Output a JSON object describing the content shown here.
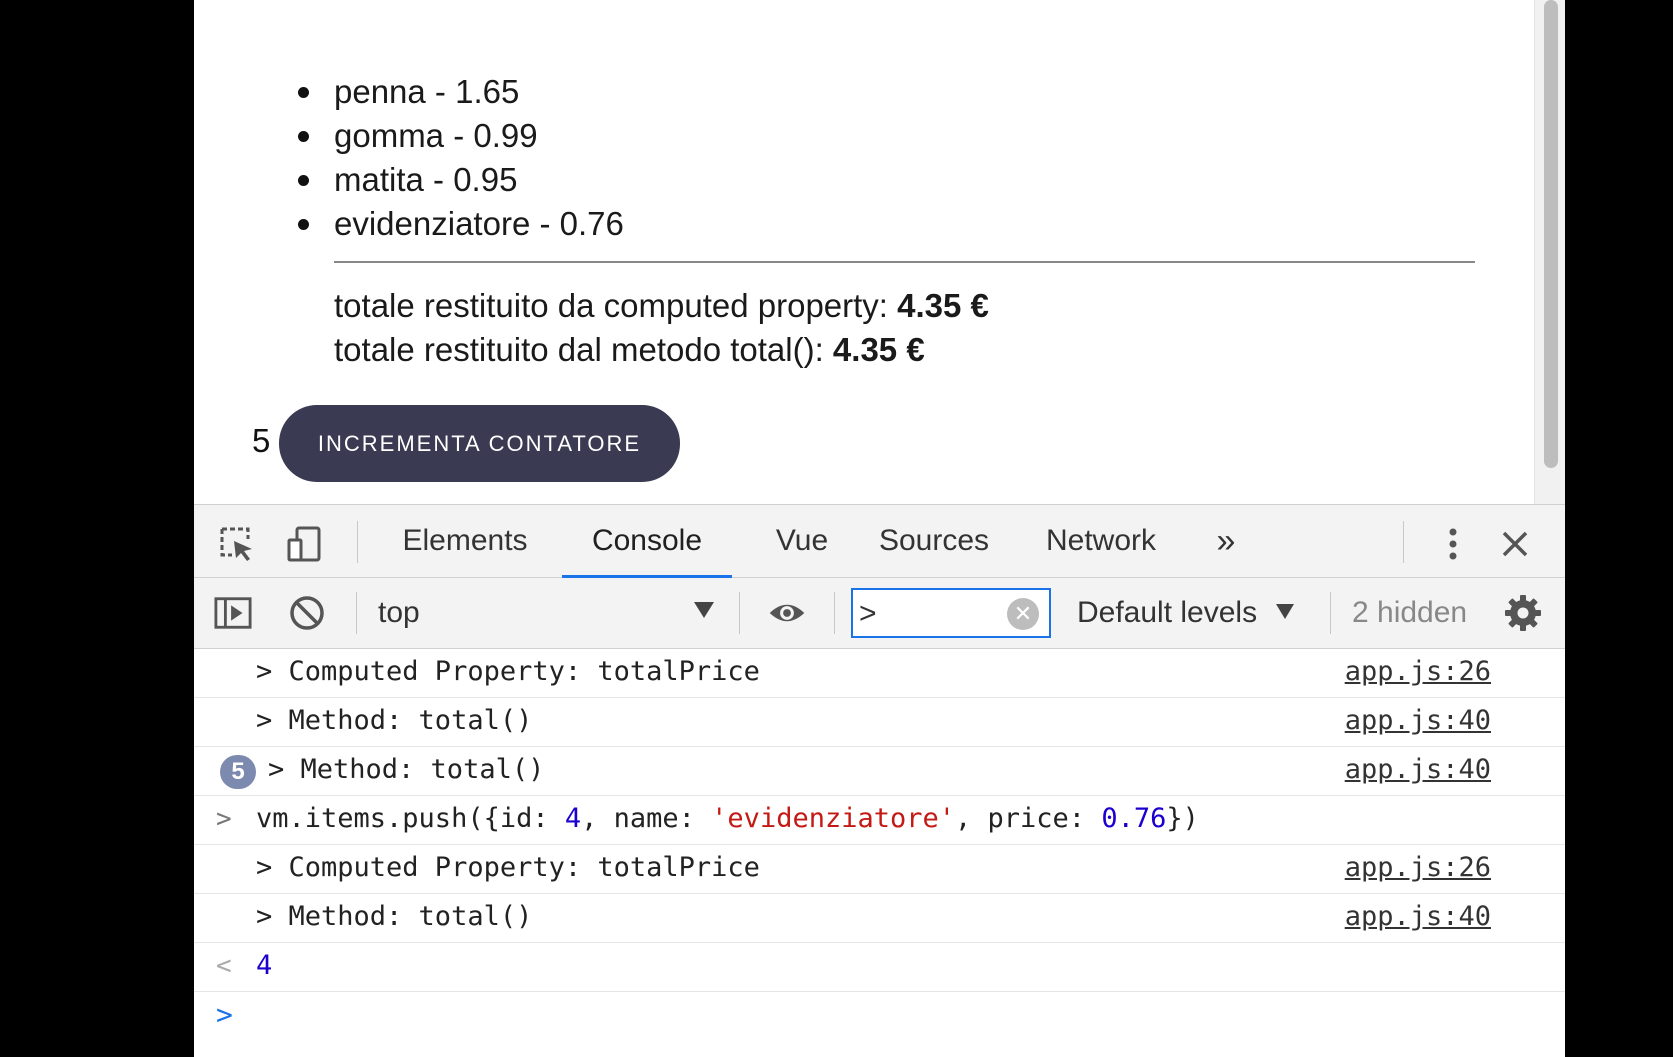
{
  "page": {
    "items": [
      "penna - 1.65",
      "gomma - 0.99",
      "matita - 0.95",
      "evidenziatore - 0.76"
    ],
    "computed_label": "totale restituito da computed property:",
    "computed_value": "4.35 €",
    "method_label": "totale restituito dal metodo total():",
    "method_value": "4.35 €",
    "counter": "5",
    "increment_button": "INCREMENTA CONTATORE"
  },
  "devtools": {
    "tabs": [
      "Elements",
      "Console",
      "Vue",
      "Sources",
      "Network"
    ],
    "active_tab": "Console",
    "more_tabs": "»",
    "context": "top",
    "filter_value": ">",
    "levels": "Default levels",
    "hidden": "2 hidden"
  },
  "console": {
    "rows": [
      {
        "msg": "> Computed Property: totalPrice",
        "src": "app.js:26"
      },
      {
        "msg": "> Method: total()",
        "src": "app.js:40"
      },
      {
        "count": "5",
        "msg": "> Method: total()",
        "src": "app.js:40"
      }
    ],
    "input_line": {
      "prefix": ">",
      "pre": "vm.items.push({id: ",
      "id": "4",
      "mid": ", name: ",
      "name": "'evidenziatore'",
      "mid2": ", price: ",
      "price": "0.76",
      "post": "})"
    },
    "rows2": [
      {
        "msg": "> Computed Property: totalPrice",
        "src": "app.js:26"
      },
      {
        "msg": "> Method: total()",
        "src": "app.js:40"
      }
    ],
    "result_prefix": "<",
    "result": "4",
    "prompt": ">"
  }
}
